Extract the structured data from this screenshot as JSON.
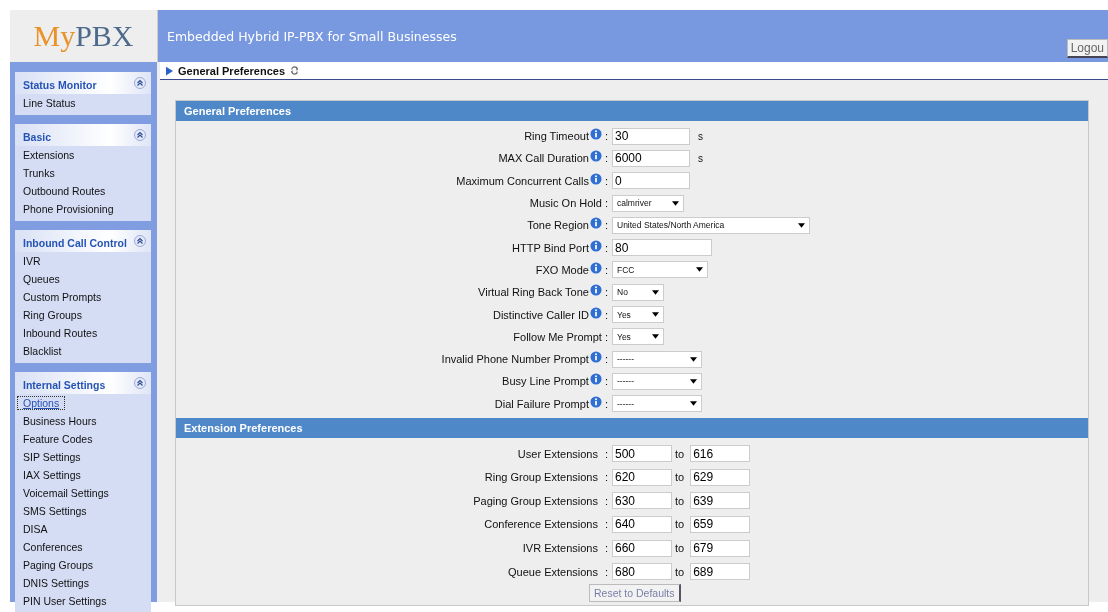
{
  "header": {
    "logo_prefix": "My",
    "logo_suffix": "PBX",
    "tagline": "Embedded Hybrid IP-PBX for Small Businesses",
    "logout": "Logou"
  },
  "sidebar": [
    {
      "title": "Status Monitor",
      "expanded": true,
      "items": [
        {
          "label": "Line Status",
          "selected": false
        }
      ]
    },
    {
      "title": "Basic",
      "expanded": true,
      "items": [
        {
          "label": "Extensions",
          "selected": false
        },
        {
          "label": "Trunks",
          "selected": false
        },
        {
          "label": "Outbound Routes",
          "selected": false
        },
        {
          "label": "Phone Provisioning",
          "selected": false
        }
      ]
    },
    {
      "title": "Inbound Call Control",
      "expanded": true,
      "items": [
        {
          "label": "IVR",
          "selected": false
        },
        {
          "label": "Queues",
          "selected": false
        },
        {
          "label": "Custom Prompts",
          "selected": false
        },
        {
          "label": "Ring Groups",
          "selected": false
        },
        {
          "label": "Inbound Routes",
          "selected": false
        },
        {
          "label": "Blacklist",
          "selected": false
        }
      ]
    },
    {
      "title": "Internal Settings",
      "expanded": true,
      "items": [
        {
          "label": "Options",
          "selected": true
        },
        {
          "label": "Business Hours",
          "selected": false
        },
        {
          "label": "Feature Codes",
          "selected": false
        },
        {
          "label": "SIP Settings",
          "selected": false
        },
        {
          "label": "IAX Settings",
          "selected": false
        },
        {
          "label": "Voicemail Settings",
          "selected": false
        },
        {
          "label": "SMS Settings",
          "selected": false
        },
        {
          "label": "DISA",
          "selected": false
        },
        {
          "label": "Conferences",
          "selected": false
        },
        {
          "label": "Paging Groups",
          "selected": false
        },
        {
          "label": "DNIS Settings",
          "selected": false
        },
        {
          "label": "PIN User Settings",
          "selected": false
        }
      ]
    }
  ],
  "breadcrumb": "General Preferences",
  "general": {
    "title": "General Preferences",
    "fields": [
      {
        "kind": "text",
        "label": "Ring Timeout",
        "info": true,
        "colon": ":",
        "value": "30",
        "unit": "s"
      },
      {
        "kind": "text",
        "label": "MAX Call Duration",
        "info": true,
        "colon": ":",
        "value": "6000",
        "unit": "s"
      },
      {
        "kind": "text",
        "label": "Maximum Concurrent Calls",
        "info": true,
        "colon": ":",
        "value": "0"
      },
      {
        "kind": "select",
        "label": "Music On Hold",
        "info": false,
        "colon": ":",
        "value": "calmriver"
      },
      {
        "kind": "select",
        "label": "Tone Region",
        "info": true,
        "colon": ":",
        "value": "United States/North America"
      },
      {
        "kind": "text",
        "label": "HTTP Bind Port",
        "info": true,
        "colon": ":",
        "value": "80"
      },
      {
        "kind": "select",
        "label": "FXO Mode",
        "info": true,
        "colon": ":",
        "value": "FCC"
      },
      {
        "kind": "select",
        "label": "Virtual Ring Back Tone",
        "info": true,
        "colon": ":",
        "value": "No"
      },
      {
        "kind": "select",
        "label": "Distinctive Caller ID",
        "info": true,
        "colon": ":",
        "value": "Yes"
      },
      {
        "kind": "select",
        "label": "Follow Me Prompt",
        "info": false,
        "colon": ":",
        "value": "Yes"
      },
      {
        "kind": "select",
        "label": "Invalid Phone Number Prompt",
        "info": true,
        "colon": ":",
        "value": "------"
      },
      {
        "kind": "select",
        "label": "Busy Line Prompt",
        "info": true,
        "colon": ":",
        "value": "------"
      },
      {
        "kind": "select",
        "label": "Dial Failure Prompt",
        "info": true,
        "colon": ":",
        "value": "------"
      }
    ]
  },
  "extensions": {
    "title": "Extension Preferences",
    "rows": [
      {
        "label": "User Extensions",
        "colon": ":",
        "from": "500",
        "to_word": "to",
        "to": "616"
      },
      {
        "label": "Ring Group Extensions",
        "colon": ":",
        "from": "620",
        "to_word": "to",
        "to": "629"
      },
      {
        "label": "Paging Group Extensions",
        "colon": ":",
        "from": "630",
        "to_word": "to",
        "to": "639"
      },
      {
        "label": "Conference Extensions",
        "colon": ":",
        "from": "640",
        "to_word": "to",
        "to": "659"
      },
      {
        "label": "IVR Extensions",
        "colon": ":",
        "from": "660",
        "to_word": "to",
        "to": "679"
      },
      {
        "label": "Queue Extensions",
        "colon": ":",
        "from": "680",
        "to_word": "to",
        "to": "689"
      }
    ],
    "reset": "Reset to Defaults"
  }
}
